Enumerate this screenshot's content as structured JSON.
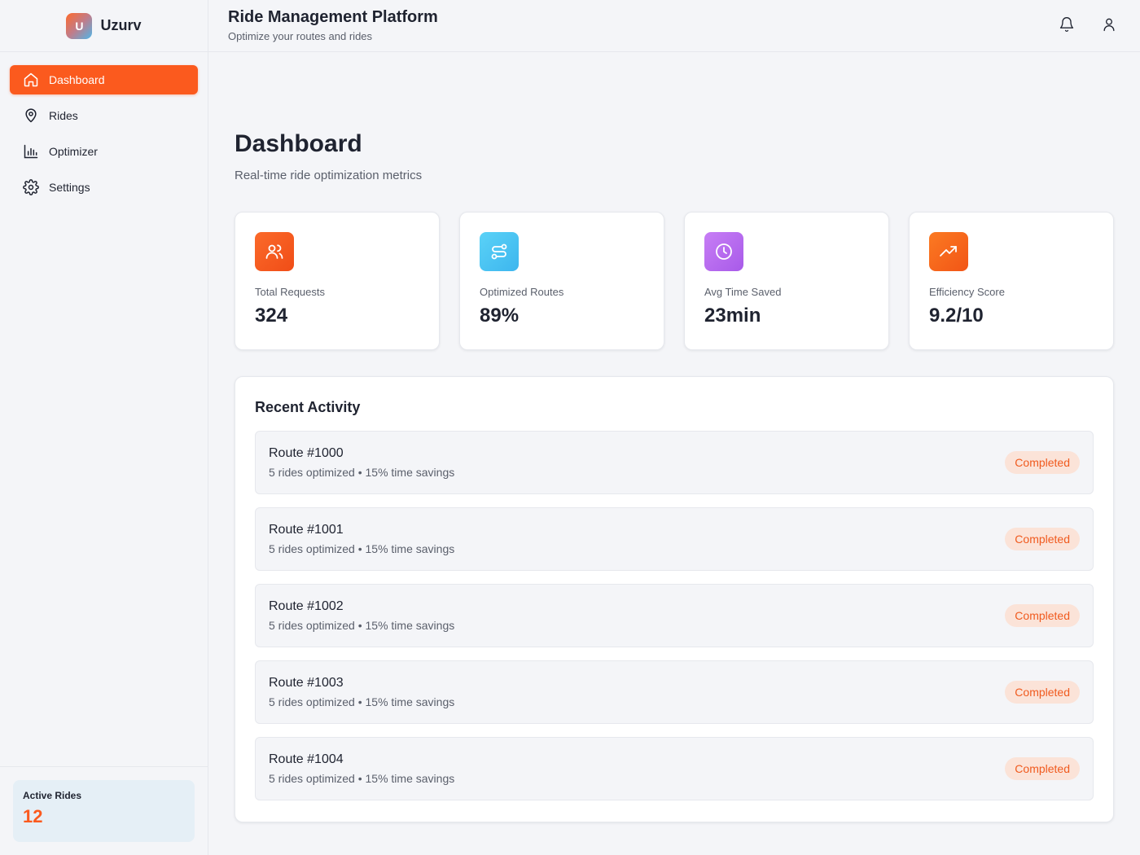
{
  "brand": {
    "logo_letter": "U",
    "name": "Uzurv"
  },
  "sidebar": {
    "items": [
      {
        "label": "Dashboard",
        "icon": "home-icon",
        "active": true
      },
      {
        "label": "Rides",
        "icon": "map-pin-icon",
        "active": false
      },
      {
        "label": "Optimizer",
        "icon": "bar-chart-icon",
        "active": false
      },
      {
        "label": "Settings",
        "icon": "gear-icon",
        "active": false
      }
    ],
    "active_rides": {
      "label": "Active Rides",
      "value": "12"
    }
  },
  "header": {
    "title": "Ride Management Platform",
    "subtitle": "Optimize your routes and rides",
    "icons": [
      "bell-icon",
      "user-icon"
    ]
  },
  "main": {
    "title": "Dashboard",
    "subtitle": "Real-time ride optimization metrics",
    "stats": [
      {
        "label": "Total Requests",
        "value": "324",
        "icon": "users-icon",
        "color": "#fb5a1e"
      },
      {
        "label": "Optimized Routes",
        "value": "89%",
        "icon": "route-icon",
        "color": "#4cc3f2"
      },
      {
        "label": "Avg Time Saved",
        "value": "23min",
        "icon": "clock-icon",
        "color": "#b46af0"
      },
      {
        "label": "Efficiency Score",
        "value": "9.2/10",
        "icon": "trending-up-icon",
        "color": "#fb6a1e"
      }
    ],
    "activity": {
      "title": "Recent Activity",
      "items": [
        {
          "title": "Route #1000",
          "detail": "5 rides optimized • 15% time savings",
          "status": "Completed"
        },
        {
          "title": "Route #1001",
          "detail": "5 rides optimized • 15% time savings",
          "status": "Completed"
        },
        {
          "title": "Route #1002",
          "detail": "5 rides optimized • 15% time savings",
          "status": "Completed"
        },
        {
          "title": "Route #1003",
          "detail": "5 rides optimized • 15% time savings",
          "status": "Completed"
        },
        {
          "title": "Route #1004",
          "detail": "5 rides optimized • 15% time savings",
          "status": "Completed"
        }
      ]
    }
  },
  "colors": {
    "accent": "#fb5a1e",
    "badge_bg": "#fbe3d8",
    "panel_bg": "#f4f5f8"
  }
}
